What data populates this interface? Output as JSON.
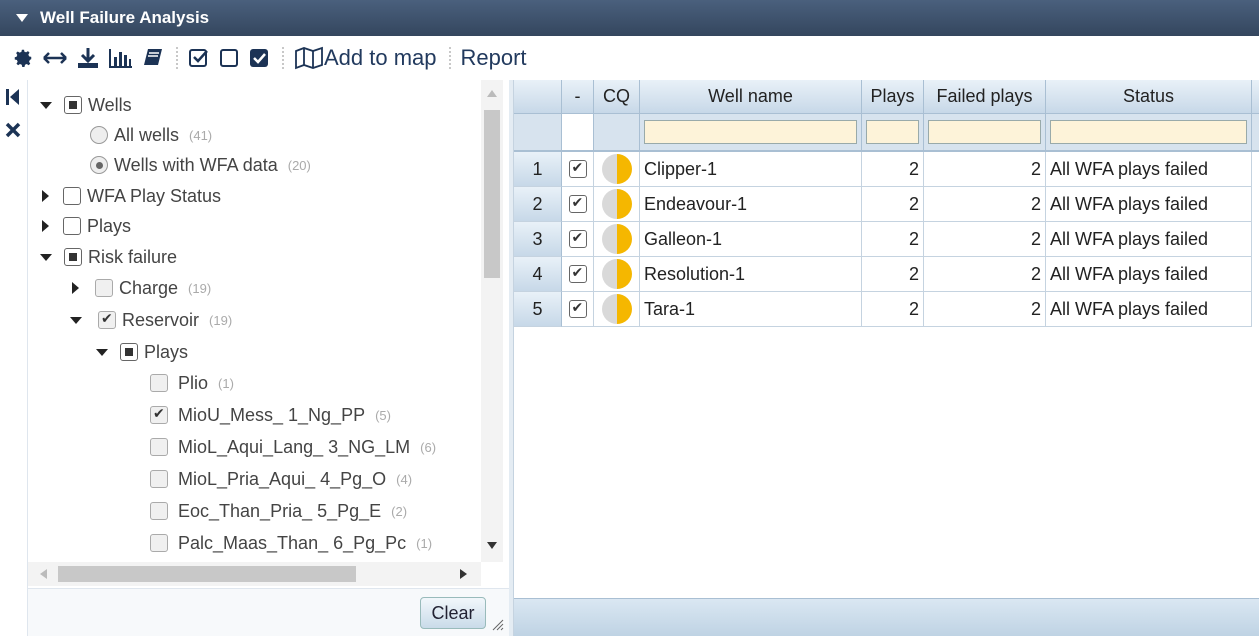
{
  "window": {
    "title": "Well Failure Analysis"
  },
  "toolbar": {
    "add_to_map": "Add to map",
    "report": "Report"
  },
  "tree": {
    "wells": {
      "label": "Wells"
    },
    "all_wells": {
      "label": "All wells",
      "count": "(41)"
    },
    "wells_wfa": {
      "label": "Wells with WFA data",
      "count": "(20)"
    },
    "wfa_status": {
      "label": "WFA Play Status"
    },
    "plays": {
      "label": "Plays"
    },
    "risk": {
      "label": "Risk failure"
    },
    "charge": {
      "label": "Charge",
      "count": "(19)"
    },
    "reservoir": {
      "label": "Reservoir",
      "count": "(19)"
    },
    "res_plays": {
      "label": "Plays"
    },
    "items": [
      {
        "label": "Plio",
        "count": "(1)",
        "checked": false
      },
      {
        "label": "MioU_Mess_ 1_Ng_PP",
        "count": "(5)",
        "checked": true
      },
      {
        "label": "MioL_Aqui_Lang_ 3_NG_LM",
        "count": "(6)",
        "checked": false
      },
      {
        "label": "MioL_Pria_Aqui_ 4_Pg_O",
        "count": "(4)",
        "checked": false
      },
      {
        "label": "Eoc_Than_Pria_ 5_Pg_E",
        "count": "(2)",
        "checked": false
      },
      {
        "label": "Palc_Maas_Than_ 6_Pg_Pc",
        "count": "(1)",
        "checked": false
      }
    ]
  },
  "footer": {
    "clear": "Clear"
  },
  "grid": {
    "headers": {
      "check": "-",
      "cq": "CQ",
      "name": "Well name",
      "plays": "Plays",
      "failed": "Failed plays",
      "status": "Status"
    },
    "rows": [
      {
        "num": "1",
        "name": "Clipper-1",
        "plays": "2",
        "failed": "2",
        "status": "All WFA plays failed"
      },
      {
        "num": "2",
        "name": "Endeavour-1",
        "plays": "2",
        "failed": "2",
        "status": "All WFA plays failed"
      },
      {
        "num": "3",
        "name": "Galleon-1",
        "plays": "2",
        "failed": "2",
        "status": "All WFA plays failed"
      },
      {
        "num": "4",
        "name": "Resolution-1",
        "plays": "2",
        "failed": "2",
        "status": "All WFA plays failed"
      },
      {
        "num": "5",
        "name": "Tara-1",
        "plays": "2",
        "failed": "2",
        "status": "All WFA plays failed"
      }
    ]
  },
  "colors": {
    "titlebar": "#3d516b",
    "cq_fill": "#f5b700",
    "header": "#c7d8e8",
    "filter_input": "#fdf3d9"
  }
}
